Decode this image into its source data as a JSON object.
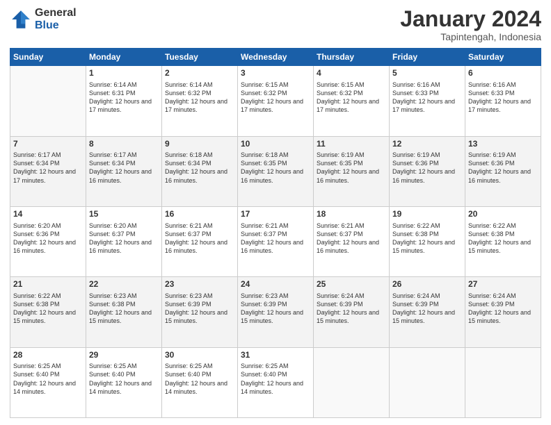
{
  "logo": {
    "general": "General",
    "blue": "Blue"
  },
  "title": {
    "month": "January 2024",
    "location": "Tapintengah, Indonesia"
  },
  "header_days": [
    "Sunday",
    "Monday",
    "Tuesday",
    "Wednesday",
    "Thursday",
    "Friday",
    "Saturday"
  ],
  "weeks": [
    [
      {
        "day": "",
        "sunrise": "",
        "sunset": "",
        "daylight": ""
      },
      {
        "day": "1",
        "sunrise": "Sunrise: 6:14 AM",
        "sunset": "Sunset: 6:31 PM",
        "daylight": "Daylight: 12 hours and 17 minutes."
      },
      {
        "day": "2",
        "sunrise": "Sunrise: 6:14 AM",
        "sunset": "Sunset: 6:32 PM",
        "daylight": "Daylight: 12 hours and 17 minutes."
      },
      {
        "day": "3",
        "sunrise": "Sunrise: 6:15 AM",
        "sunset": "Sunset: 6:32 PM",
        "daylight": "Daylight: 12 hours and 17 minutes."
      },
      {
        "day": "4",
        "sunrise": "Sunrise: 6:15 AM",
        "sunset": "Sunset: 6:32 PM",
        "daylight": "Daylight: 12 hours and 17 minutes."
      },
      {
        "day": "5",
        "sunrise": "Sunrise: 6:16 AM",
        "sunset": "Sunset: 6:33 PM",
        "daylight": "Daylight: 12 hours and 17 minutes."
      },
      {
        "day": "6",
        "sunrise": "Sunrise: 6:16 AM",
        "sunset": "Sunset: 6:33 PM",
        "daylight": "Daylight: 12 hours and 17 minutes."
      }
    ],
    [
      {
        "day": "7",
        "sunrise": "Sunrise: 6:17 AM",
        "sunset": "Sunset: 6:34 PM",
        "daylight": "Daylight: 12 hours and 17 minutes."
      },
      {
        "day": "8",
        "sunrise": "Sunrise: 6:17 AM",
        "sunset": "Sunset: 6:34 PM",
        "daylight": "Daylight: 12 hours and 16 minutes."
      },
      {
        "day": "9",
        "sunrise": "Sunrise: 6:18 AM",
        "sunset": "Sunset: 6:34 PM",
        "daylight": "Daylight: 12 hours and 16 minutes."
      },
      {
        "day": "10",
        "sunrise": "Sunrise: 6:18 AM",
        "sunset": "Sunset: 6:35 PM",
        "daylight": "Daylight: 12 hours and 16 minutes."
      },
      {
        "day": "11",
        "sunrise": "Sunrise: 6:19 AM",
        "sunset": "Sunset: 6:35 PM",
        "daylight": "Daylight: 12 hours and 16 minutes."
      },
      {
        "day": "12",
        "sunrise": "Sunrise: 6:19 AM",
        "sunset": "Sunset: 6:36 PM",
        "daylight": "Daylight: 12 hours and 16 minutes."
      },
      {
        "day": "13",
        "sunrise": "Sunrise: 6:19 AM",
        "sunset": "Sunset: 6:36 PM",
        "daylight": "Daylight: 12 hours and 16 minutes."
      }
    ],
    [
      {
        "day": "14",
        "sunrise": "Sunrise: 6:20 AM",
        "sunset": "Sunset: 6:36 PM",
        "daylight": "Daylight: 12 hours and 16 minutes."
      },
      {
        "day": "15",
        "sunrise": "Sunrise: 6:20 AM",
        "sunset": "Sunset: 6:37 PM",
        "daylight": "Daylight: 12 hours and 16 minutes."
      },
      {
        "day": "16",
        "sunrise": "Sunrise: 6:21 AM",
        "sunset": "Sunset: 6:37 PM",
        "daylight": "Daylight: 12 hours and 16 minutes."
      },
      {
        "day": "17",
        "sunrise": "Sunrise: 6:21 AM",
        "sunset": "Sunset: 6:37 PM",
        "daylight": "Daylight: 12 hours and 16 minutes."
      },
      {
        "day": "18",
        "sunrise": "Sunrise: 6:21 AM",
        "sunset": "Sunset: 6:37 PM",
        "daylight": "Daylight: 12 hours and 16 minutes."
      },
      {
        "day": "19",
        "sunrise": "Sunrise: 6:22 AM",
        "sunset": "Sunset: 6:38 PM",
        "daylight": "Daylight: 12 hours and 15 minutes."
      },
      {
        "day": "20",
        "sunrise": "Sunrise: 6:22 AM",
        "sunset": "Sunset: 6:38 PM",
        "daylight": "Daylight: 12 hours and 15 minutes."
      }
    ],
    [
      {
        "day": "21",
        "sunrise": "Sunrise: 6:22 AM",
        "sunset": "Sunset: 6:38 PM",
        "daylight": "Daylight: 12 hours and 15 minutes."
      },
      {
        "day": "22",
        "sunrise": "Sunrise: 6:23 AM",
        "sunset": "Sunset: 6:38 PM",
        "daylight": "Daylight: 12 hours and 15 minutes."
      },
      {
        "day": "23",
        "sunrise": "Sunrise: 6:23 AM",
        "sunset": "Sunset: 6:39 PM",
        "daylight": "Daylight: 12 hours and 15 minutes."
      },
      {
        "day": "24",
        "sunrise": "Sunrise: 6:23 AM",
        "sunset": "Sunset: 6:39 PM",
        "daylight": "Daylight: 12 hours and 15 minutes."
      },
      {
        "day": "25",
        "sunrise": "Sunrise: 6:24 AM",
        "sunset": "Sunset: 6:39 PM",
        "daylight": "Daylight: 12 hours and 15 minutes."
      },
      {
        "day": "26",
        "sunrise": "Sunrise: 6:24 AM",
        "sunset": "Sunset: 6:39 PM",
        "daylight": "Daylight: 12 hours and 15 minutes."
      },
      {
        "day": "27",
        "sunrise": "Sunrise: 6:24 AM",
        "sunset": "Sunset: 6:39 PM",
        "daylight": "Daylight: 12 hours and 15 minutes."
      }
    ],
    [
      {
        "day": "28",
        "sunrise": "Sunrise: 6:25 AM",
        "sunset": "Sunset: 6:40 PM",
        "daylight": "Daylight: 12 hours and 14 minutes."
      },
      {
        "day": "29",
        "sunrise": "Sunrise: 6:25 AM",
        "sunset": "Sunset: 6:40 PM",
        "daylight": "Daylight: 12 hours and 14 minutes."
      },
      {
        "day": "30",
        "sunrise": "Sunrise: 6:25 AM",
        "sunset": "Sunset: 6:40 PM",
        "daylight": "Daylight: 12 hours and 14 minutes."
      },
      {
        "day": "31",
        "sunrise": "Sunrise: 6:25 AM",
        "sunset": "Sunset: 6:40 PM",
        "daylight": "Daylight: 12 hours and 14 minutes."
      },
      {
        "day": "",
        "sunrise": "",
        "sunset": "",
        "daylight": ""
      },
      {
        "day": "",
        "sunrise": "",
        "sunset": "",
        "daylight": ""
      },
      {
        "day": "",
        "sunrise": "",
        "sunset": "",
        "daylight": ""
      }
    ]
  ]
}
